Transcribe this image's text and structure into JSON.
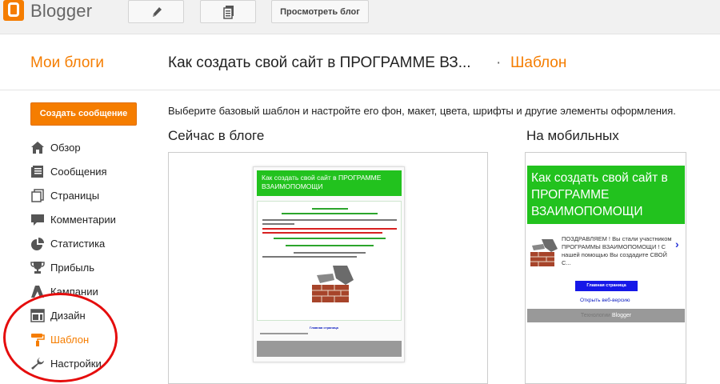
{
  "app": {
    "name": "Blogger"
  },
  "toolbar": {
    "new_post_icon": "pencil-icon",
    "pages_icon": "pages-icon",
    "view_blog_label": "Просмотреть блог"
  },
  "header": {
    "my_blogs": "Мои блоги",
    "blog_title": "Как создать свой сайт в ПРОГРАММЕ ВЗ...",
    "separator": "·",
    "section": "Шаблон"
  },
  "sidebar": {
    "new_post_label": "Создать сообщение",
    "items": [
      {
        "label": "Обзор",
        "icon": "home-icon"
      },
      {
        "label": "Сообщения",
        "icon": "posts-icon"
      },
      {
        "label": "Страницы",
        "icon": "pages-icon"
      },
      {
        "label": "Комментарии",
        "icon": "comment-icon"
      },
      {
        "label": "Статистика",
        "icon": "pie-chart-icon"
      },
      {
        "label": "Прибыль",
        "icon": "trophy-icon"
      },
      {
        "label": "Кампании",
        "icon": "adwords-icon"
      },
      {
        "label": "Дизайн",
        "icon": "layout-icon"
      },
      {
        "label": "Шаблон",
        "icon": "paint-roller-icon",
        "active": true
      },
      {
        "label": "Настройки",
        "icon": "wrench-icon"
      }
    ]
  },
  "main": {
    "description": "Выберите базовый шаблон и настройте его фон, макет, цвета, шрифты и другие элементы оформления.",
    "now_heading": "Сейчас в блоге",
    "mobile_heading": "На мобильных",
    "preview": {
      "title": "Как создать свой сайт в ПРОГРАММЕ ВЗАИМОПОМОЩИ",
      "home_link": "Главная страница"
    },
    "mobile": {
      "title": "Как создать свой сайт в ПРОГРАММЕ ВЗАИМОПОМОЩИ",
      "snippet": "ПОЗДРАВЛЯЕМ ! Вы стали участником ПРОГРАММЫ ВЗАИМОПОМОЩИ ! С нашей помощью Вы создадите СВОЙ С...",
      "arrow": "›",
      "home_button": "Главная страница",
      "web_version": "Открыть веб-версию",
      "footer_prefix": "Технологии",
      "footer_brand": "Blogger"
    }
  },
  "colors": {
    "accent": "#f57d00",
    "header_green": "#22c21e",
    "annotation_red": "#e50d0d"
  }
}
